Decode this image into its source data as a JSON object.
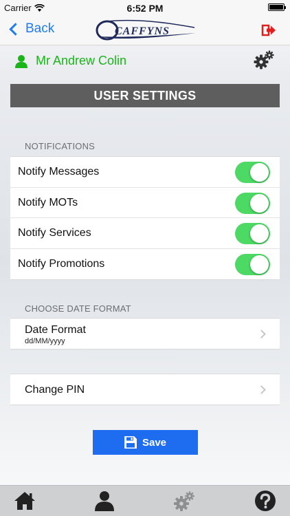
{
  "status_bar": {
    "carrier": "Carrier",
    "time": "6:52 PM"
  },
  "nav": {
    "back_label": "Back",
    "logo_text": "CAFFYNS"
  },
  "user": {
    "name": "Mr Andrew Colin"
  },
  "page_title": "USER SETTINGS",
  "notifications": {
    "header": "NOTIFICATIONS",
    "items": [
      {
        "label": "Notify Messages",
        "on": true
      },
      {
        "label": "Notify MOTs",
        "on": true
      },
      {
        "label": "Notify Services",
        "on": true
      },
      {
        "label": "Notify Promotions",
        "on": true
      }
    ]
  },
  "date_format": {
    "header": "CHOOSE DATE FORMAT",
    "label": "Date Format",
    "value": "dd/MM/yyyy"
  },
  "pin": {
    "label": "Change PIN"
  },
  "save_label": "Save",
  "colors": {
    "accent_blue": "#1e6cf0",
    "toggle_green": "#4cd964",
    "user_green": "#1bb51b",
    "title_bar": "#5e5e5e",
    "logout_red": "#e02020"
  },
  "tabs": [
    {
      "icon": "home-icon"
    },
    {
      "icon": "profile-icon"
    },
    {
      "icon": "settings-icon"
    },
    {
      "icon": "help-icon"
    }
  ]
}
